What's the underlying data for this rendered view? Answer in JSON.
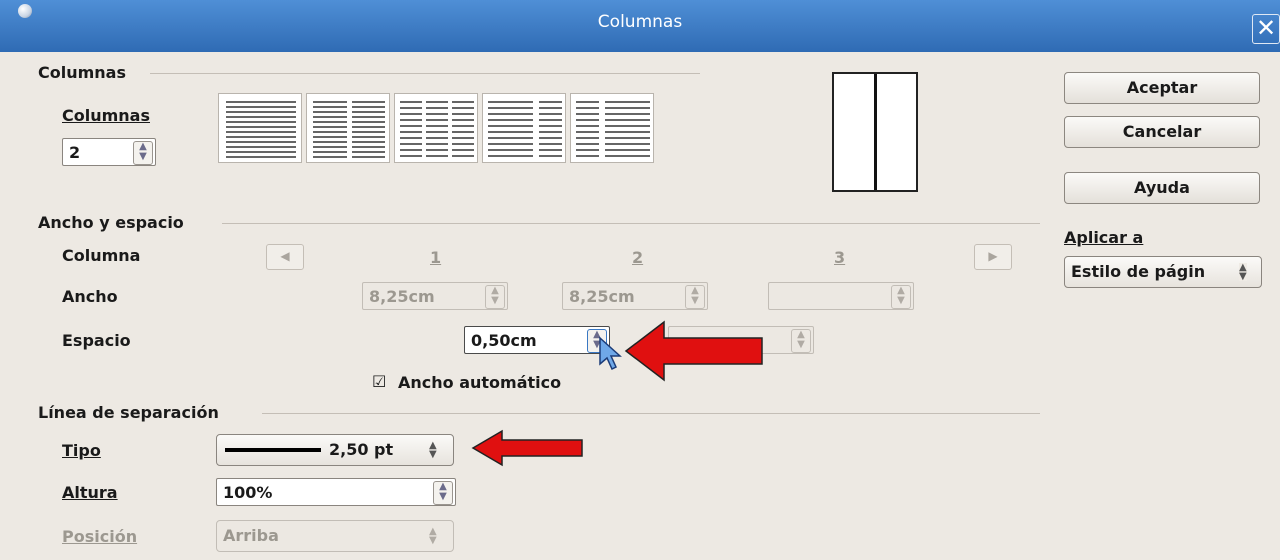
{
  "window": {
    "title": "Columnas",
    "close_glyph": "✕"
  },
  "columns_section": {
    "heading": "Columnas",
    "columns_label": "Columnas",
    "columns_value": "2",
    "preset_count": 5
  },
  "width_spacing": {
    "heading": "Ancho y espacio",
    "column_label": "Columna",
    "width_label": "Ancho",
    "spacing_label": "Espacio",
    "col_numbers": [
      "1",
      "2",
      "3"
    ],
    "widths": [
      "8,25cm",
      "8,25cm",
      ""
    ],
    "spacing_value": "0,50cm",
    "auto_width_label": "Ancho automático",
    "auto_width_checked": true
  },
  "separator": {
    "heading": "Línea de separación",
    "type_label": "Tipo",
    "type_value": "2,50 pt",
    "height_label": "Altura",
    "height_value": "100%",
    "position_label": "Posición",
    "position_value": "Arriba"
  },
  "buttons": {
    "ok": "Aceptar",
    "cancel": "Cancelar",
    "help": "Ayuda"
  },
  "apply": {
    "label": "Aplicar a",
    "value": "Estilo de págin"
  },
  "colors": {
    "titlebar": "#3a78c3",
    "annotation_arrow": "#e01010",
    "dialog_bg": "#ede9e3"
  }
}
